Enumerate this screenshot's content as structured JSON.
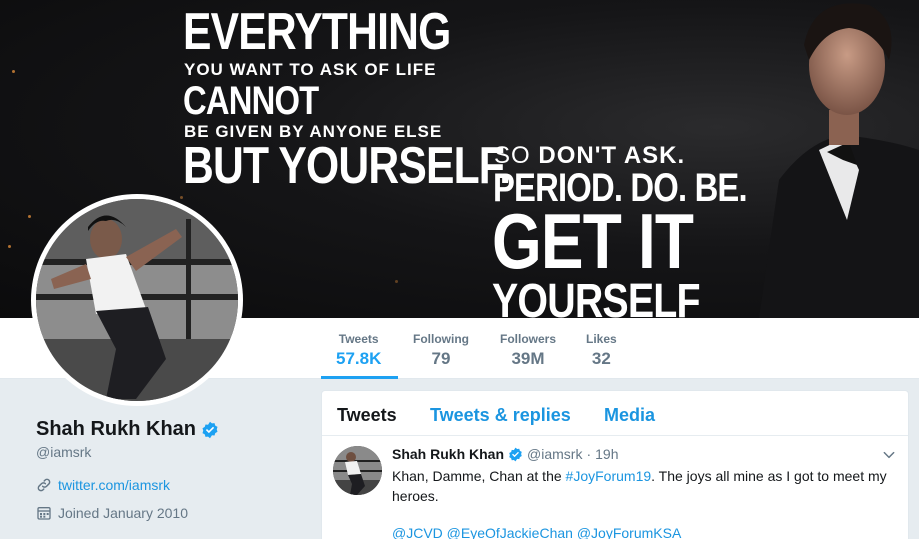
{
  "banner": {
    "line1": "Everything",
    "line2": "You want to ask of life",
    "line3": "Cannot",
    "line4": "Be given by anyone else",
    "line5": "But yourself.",
    "line6_a": "So",
    "line6_b": "don't ask.",
    "line7": "Period. Do. Be.",
    "line8": "Get it",
    "line9": "Yourself"
  },
  "stats": [
    {
      "label": "Tweets",
      "value": "57.8K"
    },
    {
      "label": "Following",
      "value": "79"
    },
    {
      "label": "Followers",
      "value": "39M"
    },
    {
      "label": "Likes",
      "value": "32"
    }
  ],
  "profile": {
    "name": "Shah Rukh Khan",
    "handle": "@iamsrk",
    "link": "twitter.com/iamsrk",
    "joined": "Joined January 2010"
  },
  "tabs": [
    "Tweets",
    "Tweets & replies",
    "Media"
  ],
  "tweet": {
    "name": "Shah Rukh Khan",
    "handle": "@iamsrk",
    "dot": "·",
    "time": "19h",
    "text_before": "Khan, Damme, Chan at the ",
    "hashtag": "#JoyForum19",
    "text_after": ". The joys all mine as I got to meet my heroes.",
    "mentions": "@JCVD @EyeOfJackieChan @JoyForumKSA"
  },
  "colors": {
    "accent": "#1da1f2",
    "link": "#1b95e0",
    "background": "#e6ecf0",
    "muted": "#657786"
  }
}
